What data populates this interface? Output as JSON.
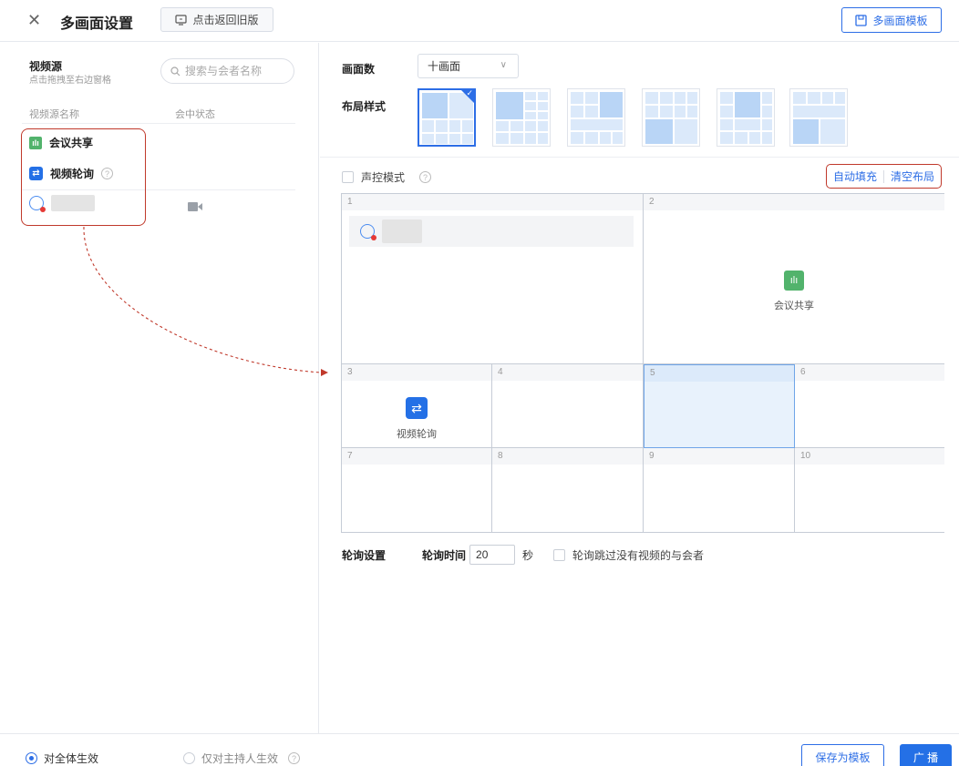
{
  "header": {
    "title": "多画面设置",
    "back_label": "点击返回旧版",
    "template_label": "多画面模板"
  },
  "left": {
    "source_title": "视频源",
    "source_subtitle": "点击拖拽至右边窗格",
    "search_placeholder": "搜索与会者名称",
    "columns": [
      "视频源名称",
      "会中状态"
    ],
    "items": [
      {
        "label": "会议共享",
        "icon": "share-icon"
      },
      {
        "label": "视频轮询",
        "icon": "poll-icon"
      }
    ]
  },
  "layout": {
    "count_label": "画面数",
    "count_value": "十画面",
    "style_label": "布局样式",
    "voice_mode": "声控模式",
    "auto_fill": "自动填充",
    "clear_layout": "清空布局",
    "cells": [
      "1",
      "2",
      "3",
      "4",
      "5",
      "6",
      "7",
      "8",
      "9",
      "10"
    ],
    "cell2_content": "会议共享",
    "cell3_content": "视频轮询"
  },
  "poll": {
    "settings_label": "轮询设置",
    "time_label": "轮询时间",
    "time_value": "20",
    "unit": "秒",
    "skip_label": "轮询跳过没有视频的与会者"
  },
  "footer": {
    "scope_all": "对全体生效",
    "scope_host": "仅对主持人生效",
    "save_template": "保存为模板",
    "broadcast": "广 播"
  },
  "colors": {
    "accent": "#2d6ee6",
    "highlight_border": "#c0392b",
    "share_green": "#52b36c"
  }
}
